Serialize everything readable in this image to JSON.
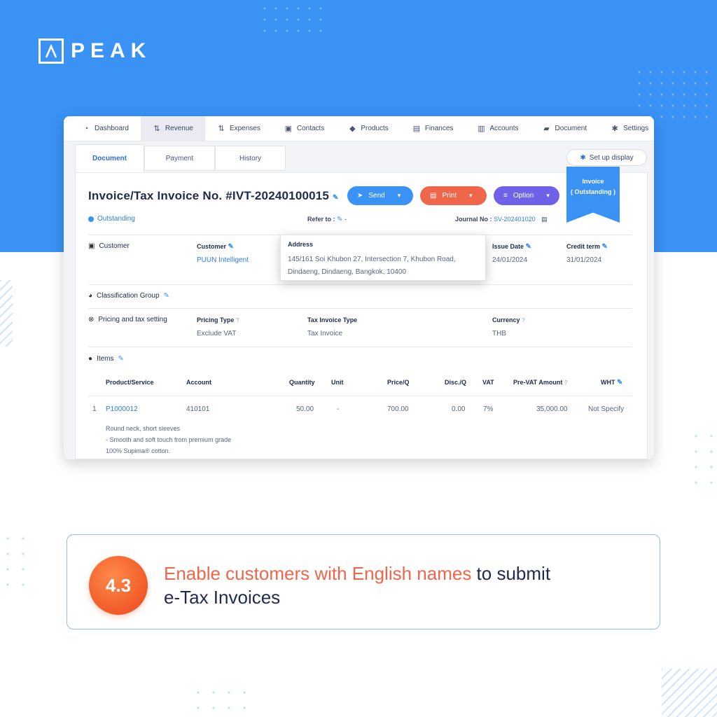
{
  "brand": {
    "logo_text": "PEAK"
  },
  "nav": [
    {
      "icon": "dashboard-icon",
      "label": "Dashboard",
      "active": false
    },
    {
      "icon": "revenue-icon",
      "label": "Revenue",
      "active": true
    },
    {
      "icon": "expenses-icon",
      "label": "Expenses",
      "active": false
    },
    {
      "icon": "contacts-icon",
      "label": "Contacts",
      "active": false
    },
    {
      "icon": "products-icon",
      "label": "Products",
      "active": false
    },
    {
      "icon": "finances-icon",
      "label": "Finances",
      "active": false
    },
    {
      "icon": "accounts-icon",
      "label": "Accounts",
      "active": false
    },
    {
      "icon": "document-icon",
      "label": "Document",
      "active": false
    },
    {
      "icon": "settings-icon",
      "label": "Settings",
      "active": false
    }
  ],
  "tabs": [
    "Document",
    "Payment",
    "History"
  ],
  "setup_display": "Set up display",
  "ribbon": {
    "line1": "Invoice",
    "line2": "( Outstanding )"
  },
  "invoice": {
    "title": "Invoice/Tax Invoice No. #IVT-20240100015",
    "status": "Outstanding",
    "refer_to_label": "Refer to :",
    "refer_to_value": "-",
    "journal_label": "Journal No :",
    "journal_value": "SV-202401020"
  },
  "buttons": {
    "send": "Send",
    "print": "Print",
    "option": "Option"
  },
  "customer": {
    "section": "Customer",
    "customer_label": "Customer",
    "customer_value": "PUUN Intelligent",
    "issue_label": "Issue Date",
    "issue_value": "24/01/2024",
    "credit_label": "Credit term",
    "credit_value": "31/01/2024"
  },
  "address_popup": {
    "title": "Address",
    "line1": "145/161 Soi Khubon 27, Intersection 7, Khubon Road,",
    "line2": "Dindaeng, Dindaeng, Bangkok, 10400"
  },
  "classification": {
    "section": "Classification Group"
  },
  "pricing": {
    "section": "Pricing and tax setting",
    "pricing_type_label": "Pricing Type",
    "pricing_type_value": "Exclude VAT",
    "tax_invoice_label": "Tax Invoice Type",
    "tax_invoice_value": "Tax Invoice",
    "currency_label": "Currency",
    "currency_value": "THB"
  },
  "items": {
    "section": "Items",
    "headers": {
      "product": "Product/Service",
      "account": "Account",
      "quantity": "Quantity",
      "unit": "Unit",
      "price": "Price/Q",
      "disc": "Disc./Q",
      "vat": "VAT",
      "prevat": "Pre-VAT Amount",
      "wht": "WHT"
    },
    "rows": [
      {
        "no": "1",
        "product": "P1000012",
        "account": "410101",
        "quantity": "50.00",
        "unit": "-",
        "price": "700.00",
        "disc": "0.00",
        "vat": "7%",
        "prevat": "35,000.00",
        "wht": "Not Specify",
        "desc": [
          "Round neck, short sleeves",
          "- Smooth and soft touch from premium grade",
          "100% Supima® cotton."
        ]
      }
    ]
  },
  "feature": {
    "number": "4.3",
    "highlight": "Enable customers with English names",
    "rest_line1": " to submit",
    "line2": "e-Tax Invoices"
  },
  "colors": {
    "brand_blue": "#3a92f5",
    "accent_orange": "#f0664a",
    "option_purple": "#6f62e8"
  }
}
